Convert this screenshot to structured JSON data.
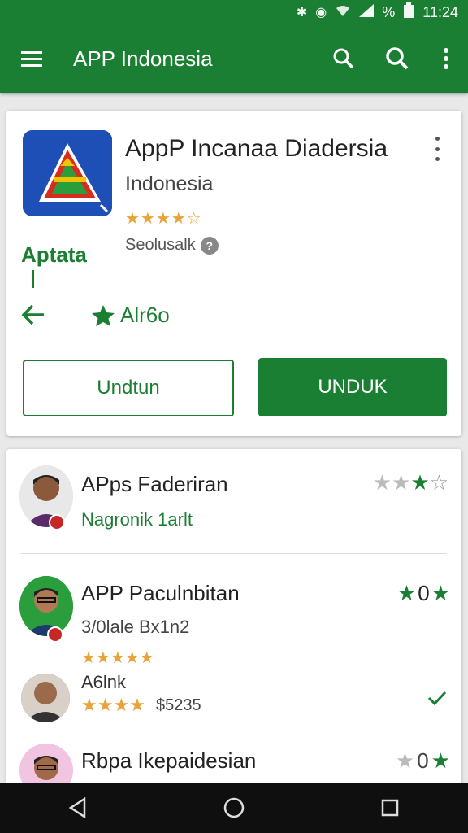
{
  "status": {
    "time": "11:24",
    "battery": "%"
  },
  "toolbar": {
    "title": "APP Indonesia"
  },
  "app": {
    "name": "AppP Incanaa Diadersia",
    "subtitle": "Indonesia",
    "stars": "★★★★☆",
    "seller": "Seolusalk",
    "brand": "Aptata",
    "fav_label": "Alr6o",
    "btn_secondary": "Undtun",
    "btn_primary": "UNDUK"
  },
  "list": [
    {
      "title": "APps Faderiran",
      "subtitle": "Nagronik 1arlt",
      "rating": "★★★☆"
    },
    {
      "title": "APP Paculnbitan",
      "subtitle": "3/0lale Bx1n2",
      "stars": "★★★★★",
      "rating_num": "0",
      "extra_title": "A6lnk",
      "extra_stars": "★★★★",
      "extra_price": "$5235"
    },
    {
      "title": "Rbpa Ikepaidesian",
      "rating_num": "0"
    }
  ],
  "colors": {
    "primary": "#1b7f33",
    "star": "#e8a33a"
  }
}
